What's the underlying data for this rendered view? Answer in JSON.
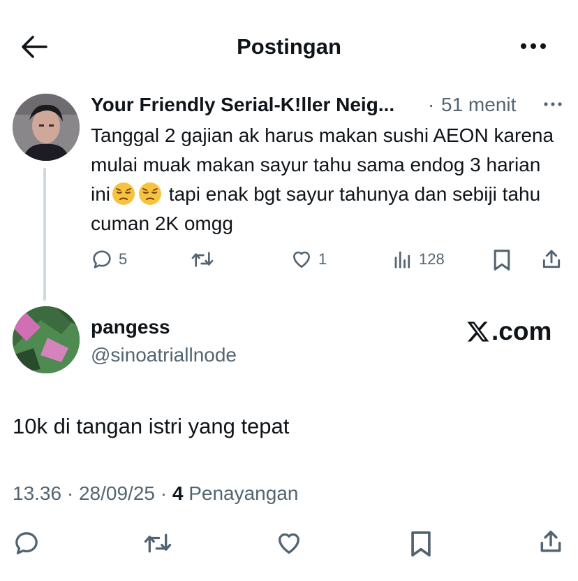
{
  "header": {
    "title": "Postingan",
    "back_icon": "arrow-left-icon",
    "more_icon": "more-horizontal-icon"
  },
  "quoted_post": {
    "author_name": "Your Friendly Serial-K!ller Neig...",
    "separator": "·",
    "time": "51 menit",
    "text_part1": "Tanggal 2 gajian ak harus makan sushi AEON karena mulai muak makan sayur tahu sama endog 3 harian ini",
    "emoji1": "😔",
    "emoji2": "😔",
    "text_part2": " tapi enak bgt sayur tahunya dan sebiji tahu cuman 2K omgg",
    "replies": "5",
    "reposts": "",
    "likes": "1",
    "views": "128"
  },
  "main_post": {
    "display_name": "pangess",
    "handle": "@sinoatriallnode",
    "watermark": ".com",
    "text": "10k di tangan istri yang tepat",
    "time": "13.36",
    "dot1": "·",
    "date": "28/09/25",
    "dot2": "·",
    "views_count": "4",
    "views_label": "Penayangan"
  },
  "colors": {
    "text": "#0f1419",
    "secondary": "#536471",
    "thread_line": "#cfd9de"
  }
}
